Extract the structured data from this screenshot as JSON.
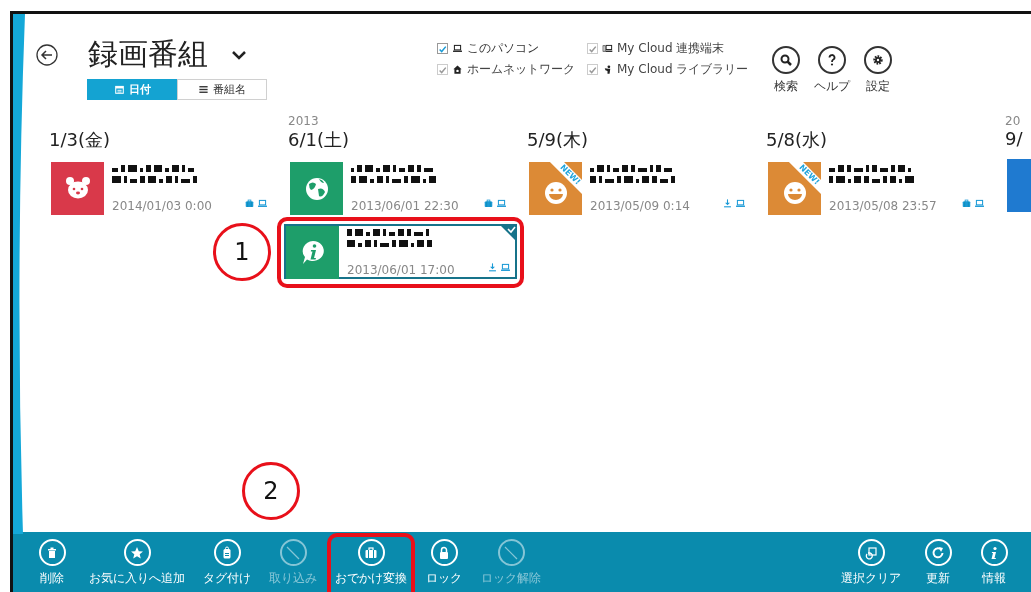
{
  "header": {
    "title": "録画番組",
    "tabs": [
      {
        "label": "日付",
        "selected": true
      },
      {
        "label": "番組名",
        "selected": false
      }
    ]
  },
  "sources": [
    {
      "label": "このパソコン",
      "checked": true,
      "disabled": false
    },
    {
      "label": "My Cloud 連携端末",
      "checked": true,
      "disabled": true
    },
    {
      "label": "ホームネットワーク",
      "checked": true,
      "disabled": true
    },
    {
      "label": "My Cloud ライブラリー",
      "checked": true,
      "disabled": true
    }
  ],
  "top_actions": [
    {
      "label": "検索"
    },
    {
      "label": "ヘルプ"
    },
    {
      "label": "設定"
    }
  ],
  "columns": [
    {
      "date": "1/3(金)",
      "recordings": [
        {
          "kind": "bear",
          "color": "#d9394a",
          "date": "2014/01/03 0:00",
          "badges": [
            {
              "kind": "briefcase"
            },
            {
              "kind": "laptop"
            }
          ],
          "selected": false,
          "highlighted": false
        }
      ]
    },
    {
      "year": "2013",
      "date": "6/1(土)",
      "recordings": [
        {
          "kind": "globe",
          "color": "#1e9e6a",
          "date": "2013/06/01 22:30",
          "badges": [
            {
              "kind": "briefcase"
            },
            {
              "kind": "laptop"
            }
          ],
          "selected": false,
          "highlighted": false
        },
        {
          "kind": "info",
          "color": "#1e9e6a",
          "date": "2013/06/01 17:00",
          "badges": [
            {
              "kind": "download"
            },
            {
              "kind": "laptop"
            }
          ],
          "selected": true,
          "highlighted": true
        }
      ]
    },
    {
      "date": "5/9(木)",
      "recordings": [
        {
          "kind": "smile",
          "color": "#dc8a36",
          "new_badge": "NEW!",
          "date": "2013/05/09 0:14",
          "badges": [
            {
              "kind": "download"
            },
            {
              "kind": "laptop"
            }
          ],
          "selected": false,
          "highlighted": false
        }
      ]
    },
    {
      "date": "5/8(水)",
      "recordings": [
        {
          "kind": "smile",
          "color": "#dc8a36",
          "new_badge": "NEW!",
          "date": "2013/05/08 23:57",
          "badges": [
            {
              "kind": "briefcase"
            },
            {
              "kind": "laptop"
            }
          ],
          "selected": false,
          "highlighted": false
        }
      ]
    },
    {
      "year": "20",
      "date": "9/",
      "recordings": [
        {
          "kind": "blank",
          "color": "#1f7ad0",
          "selected": false,
          "highlighted": false
        }
      ]
    }
  ],
  "app_bar": {
    "left": [
      {
        "label": "削除",
        "disabled": false,
        "highlighted": false
      },
      {
        "label": "お気に入りへ追加",
        "disabled": false,
        "highlighted": false
      },
      {
        "label": "タグ付け",
        "disabled": false,
        "highlighted": false
      },
      {
        "label": "取り込み",
        "disabled": true,
        "highlighted": false
      },
      {
        "label": "おでかけ変換",
        "disabled": false,
        "highlighted": true
      },
      {
        "label": "ロック",
        "disabled": false,
        "highlighted": false
      },
      {
        "label": "ロック解除",
        "disabled": true,
        "highlighted": false
      }
    ],
    "right": [
      {
        "label": "選択クリア",
        "disabled": false,
        "highlighted": false
      },
      {
        "label": "更新",
        "disabled": false,
        "highlighted": false
      },
      {
        "label": "情報",
        "disabled": false,
        "highlighted": false
      }
    ]
  },
  "annotations": [
    {
      "label": "1"
    },
    {
      "label": "2"
    }
  ]
}
